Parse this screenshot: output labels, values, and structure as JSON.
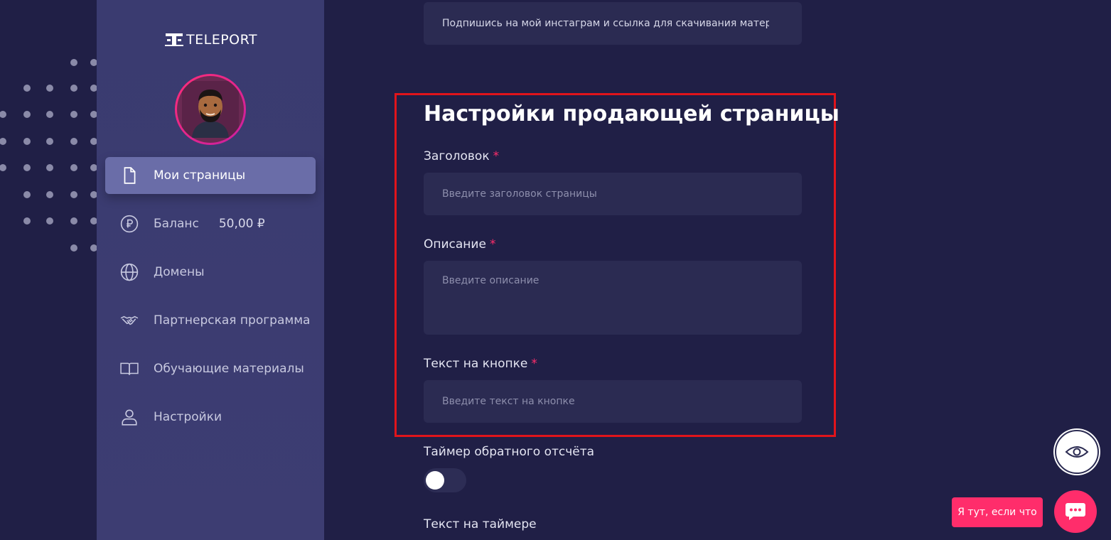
{
  "brand": {
    "name": "TELEPORT"
  },
  "sidebar": {
    "items": [
      {
        "label": "Мои страницы",
        "icon": "document-icon",
        "active": true
      },
      {
        "label": "Баланс",
        "icon": "ruble-icon",
        "value": "50,00 ₽"
      },
      {
        "label": "Домены",
        "icon": "globe-icon"
      },
      {
        "label": "Партнерская программа",
        "icon": "handshake-icon"
      },
      {
        "label": "Обучающие материалы",
        "icon": "book-icon"
      },
      {
        "label": "Настройки",
        "icon": "user-icon"
      }
    ]
  },
  "main": {
    "top_field_value": "Подпишись на мой инстаграм и ссылка для скачивания материала",
    "section_title": "Настройки продающей страницы",
    "fields": {
      "title": {
        "label": "Заголовок",
        "required": "*",
        "placeholder": "Введите заголовок страницы"
      },
      "description": {
        "label": "Описание",
        "required": "*",
        "placeholder": "Введите описание"
      },
      "button_text": {
        "label": "Текст на кнопке",
        "required": "*",
        "placeholder": "Введите текст на кнопке"
      }
    },
    "timer": {
      "label": "Таймер обратного отсчёта",
      "enabled": false
    },
    "timer_text": {
      "label": "Текст на таймере"
    }
  },
  "widgets": {
    "chat_label": "Я тут, если что"
  },
  "colors": {
    "background": "#201f46",
    "sidebar": "#3a3b70",
    "active_item": "#6a6da8",
    "input": "#2b2b52",
    "accent": "#ff2d6b",
    "highlight": "#e0141b"
  }
}
